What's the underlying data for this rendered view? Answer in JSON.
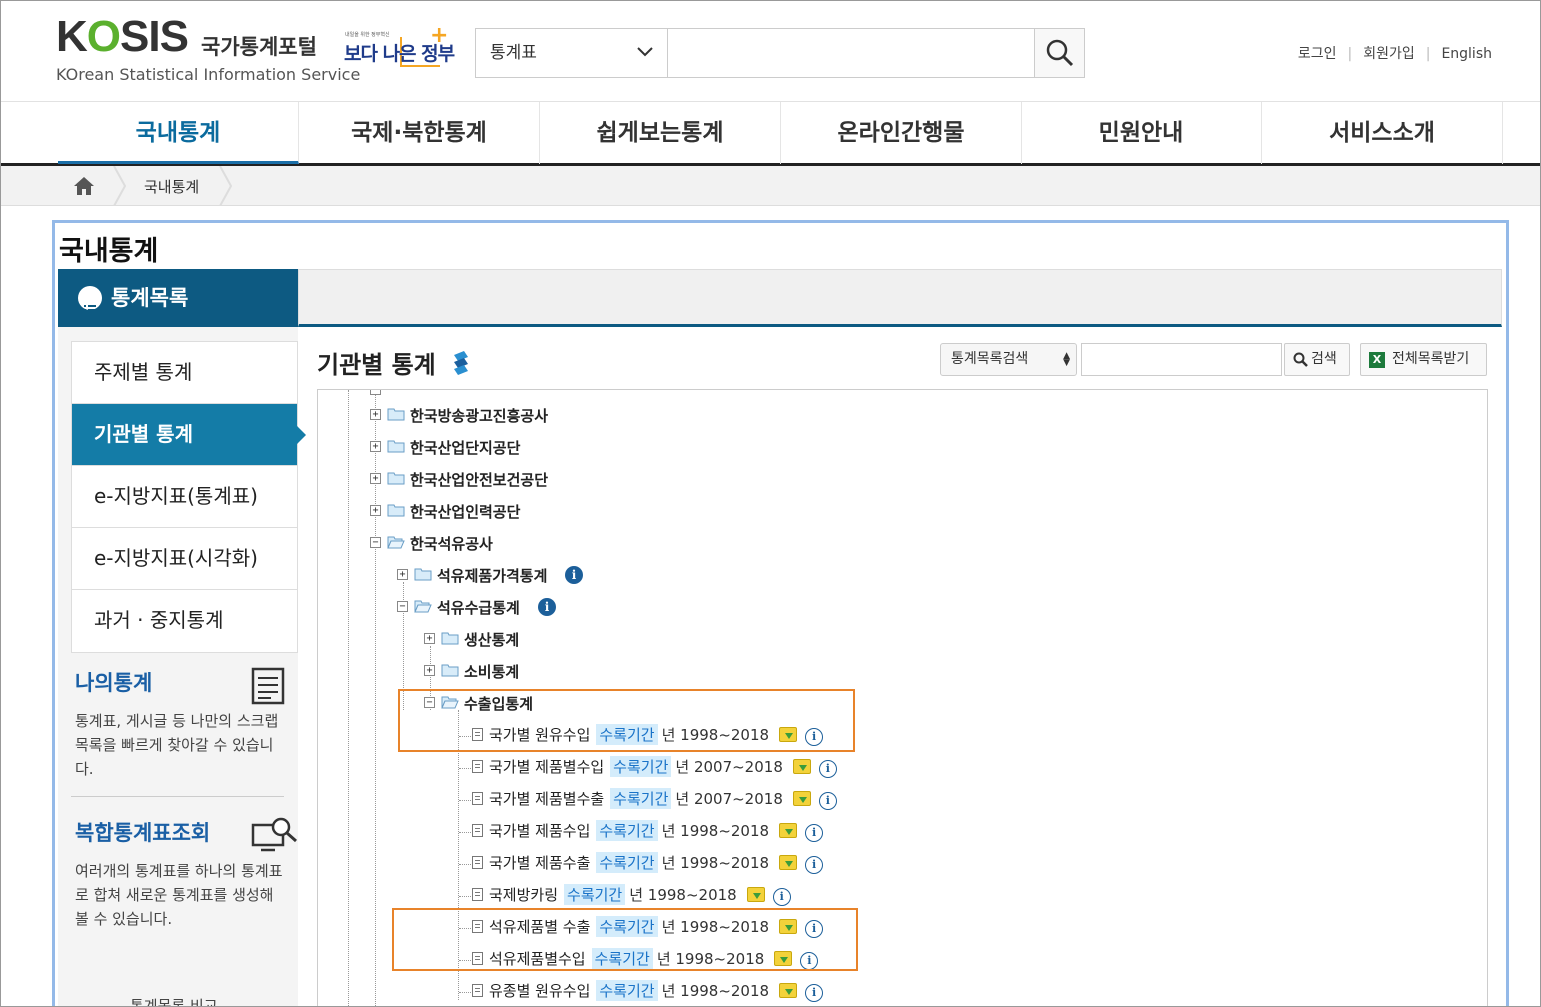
{
  "logo": {
    "text": "KOSIS",
    "portal": "국가통계포털",
    "sub": "KOrean Statistical Information Service"
  },
  "gov": {
    "tiny": "내일을 위한 정부혁신",
    "main": "보다 나은 정부"
  },
  "search": {
    "select": "통계표",
    "placeholder": "",
    "button_icon": "search-icon"
  },
  "util": {
    "login": "로그인",
    "join": "회원가입",
    "english": "English"
  },
  "gnb": [
    "국내통계",
    "국제·북한통계",
    "쉽게보는통계",
    "온라인간행물",
    "민원안내",
    "서비스소개"
  ],
  "breadcrumb": {
    "current": "국내통계"
  },
  "page_title": "국내통계",
  "left": {
    "header": "통계목록",
    "menu": [
      "주제별 통계",
      "기관별 통계",
      "e-지방지표(통계표)",
      "e-지방지표(시각화)",
      "과거 · 중지통계"
    ],
    "promo1": {
      "title": "나의통계",
      "desc": "통계표, 게시글 등 나만의 스크랩 목록을 빠르게 찾아갈 수 있습니다."
    },
    "promo2": {
      "title": "복합통계표조회",
      "desc": "여러개의 통계표를 하나의 통계표로 합쳐 새로운 통계표를 생성해 볼 수 있습니다."
    },
    "bottom_cut": "통계목록 비교"
  },
  "main": {
    "title": "기관별 통계",
    "filter": "통계목록검색",
    "search_btn": "검색",
    "download_btn": "전체목록받기"
  },
  "tree": {
    "orgs": [
      "한국방송광고진흥공사",
      "한국산업단지공단",
      "한국산업안전보건공단",
      "한국산업인력공단",
      "한국석유공사"
    ],
    "sub": [
      "석유제품가격통계",
      "석유수급통계"
    ],
    "subsub": [
      "생산통계",
      "소비통계",
      "수출입통계"
    ],
    "tag": "수록기간",
    "leaves": [
      {
        "name": "국가별 원유수입",
        "years": "년 1998~2018"
      },
      {
        "name": "국가별 제품별수입",
        "years": "년 2007~2018"
      },
      {
        "name": "국가별 제품별수출",
        "years": "년 2007~2018"
      },
      {
        "name": "국가별 제품수입",
        "years": "년 1998~2018"
      },
      {
        "name": "국가별 제품수출",
        "years": "년 1998~2018"
      },
      {
        "name": "국제방카링",
        "years": "년 1998~2018"
      },
      {
        "name": "석유제품별 수출",
        "years": "년 1998~2018"
      },
      {
        "name": "석유제품별수입",
        "years": "년 1998~2018"
      },
      {
        "name": "유종별 원유수입",
        "years": "년 1998~2018"
      }
    ]
  },
  "colors": {
    "accent": "#0d5a82",
    "active_menu": "#147ca7",
    "highlight": "#e8832a",
    "tag_bg": "#d4ecfb"
  }
}
